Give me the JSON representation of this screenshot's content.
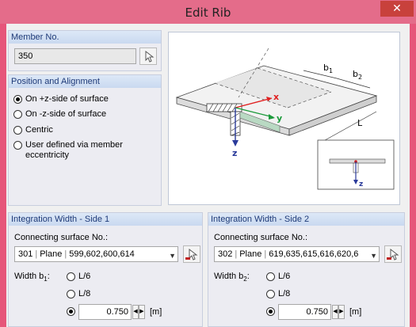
{
  "window": {
    "title": "Edit Rib",
    "close_glyph": "✕"
  },
  "member": {
    "header": "Member No.",
    "value": "350"
  },
  "position": {
    "header": "Position and Alignment",
    "options": [
      "On +z-side of surface",
      "On -z-side of surface",
      "Centric",
      "User defined via member",
      "eccentricity"
    ],
    "selected": 0
  },
  "side1": {
    "header": "Integration Width - Side 1",
    "surface_label": "Connecting surface No.:",
    "surface_no": "301",
    "surface_type": "Plane",
    "surface_list": "599,602,600,614",
    "width_label_main": "Width b",
    "width_label_sub": "1",
    "width_label_colon": ":",
    "opt1": "L/6",
    "opt2": "L/8",
    "value": "0.750",
    "unit": "[m]",
    "selected": 2
  },
  "side2": {
    "header": "Integration Width - Side 2",
    "surface_label": "Connecting surface No.:",
    "surface_no": "302",
    "surface_type": "Plane",
    "surface_list": "619,635,615,616,620,6",
    "width_label_main": "Width b",
    "width_label_sub": "2",
    "width_label_colon": ":",
    "opt1": "L/6",
    "opt2": "L/8",
    "value": "0.750",
    "unit": "[m]",
    "selected": 2
  },
  "diagram": {
    "b1_main": "b",
    "b1_sub": "1",
    "b2_main": "b",
    "b2_sub": "2",
    "L": "L",
    "x": "x",
    "y": "y",
    "z": "z",
    "inset_z": "z"
  },
  "icons": {
    "pick": "pick-cursor-icon",
    "dropdown": "dropdown-arrow-icon",
    "spin": "spin-arrows-icon"
  },
  "colors": {
    "titlebar": "#e46c8a",
    "close": "#c8413c",
    "panel_header_text": "#1e3a78",
    "axis_x": "#e02020",
    "axis_y": "#1a9a3a",
    "axis_z": "#2a3a9a"
  }
}
